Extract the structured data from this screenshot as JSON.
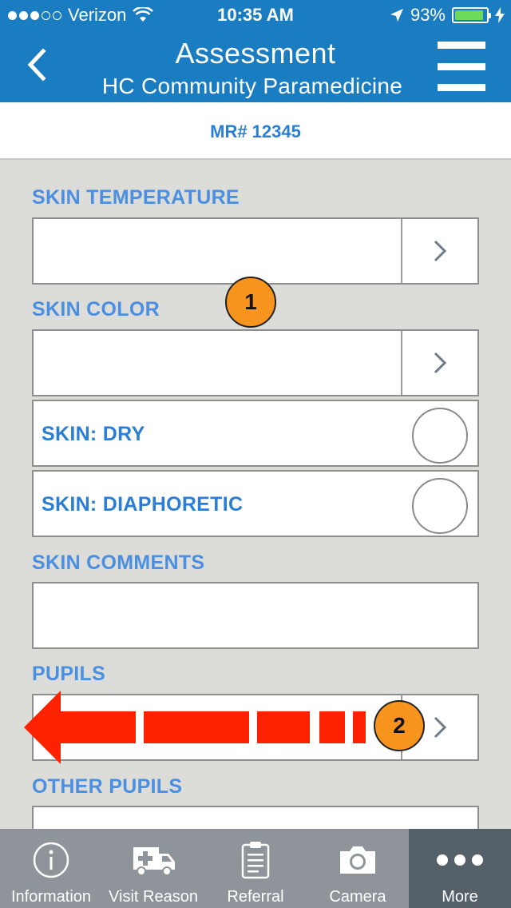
{
  "status_bar": {
    "carrier": "Verizon",
    "time": "10:35 AM",
    "battery_percent": "93%",
    "battery_level": 0.93
  },
  "nav": {
    "title": "Assessment",
    "subtitle": "HC Community Paramedicine",
    "back_icon": "chevron-left-icon",
    "menu_icon": "hamburger-menu-icon"
  },
  "record": {
    "mr_label": "MR# 12345"
  },
  "form": {
    "skin_temperature": {
      "label": "SKIN TEMPERATURE",
      "value": ""
    },
    "skin_color": {
      "label": "SKIN COLOR",
      "value": ""
    },
    "skin_dry": {
      "label": "SKIN: DRY",
      "checked": false
    },
    "skin_diaphoretic": {
      "label": "SKIN: DIAPHORETIC",
      "checked": false
    },
    "skin_comments": {
      "label": "SKIN COMMENTS",
      "value": ""
    },
    "pupils": {
      "label": "PUPILS",
      "value": ""
    },
    "other_pupils": {
      "label": "OTHER PUPILS",
      "value": ""
    }
  },
  "annotations": {
    "badge_1": "1",
    "badge_2": "2",
    "badge_color": "#f7941d",
    "arrow_color": "#ff2200"
  },
  "tabs": [
    {
      "label": "Information",
      "icon": "info-icon",
      "active": false
    },
    {
      "label": "Visit Reason",
      "icon": "ambulance-icon",
      "active": false
    },
    {
      "label": "Referral",
      "icon": "clipboard-icon",
      "active": false
    },
    {
      "label": "Camera",
      "icon": "camera-icon",
      "active": false
    },
    {
      "label": "More",
      "icon": "more-dots-icon",
      "active": true
    }
  ],
  "colors": {
    "header_blue": "#1a7cc1",
    "label_blue": "#4a8fe2",
    "tab_bar": "#8e949a",
    "tab_active": "#566069"
  }
}
